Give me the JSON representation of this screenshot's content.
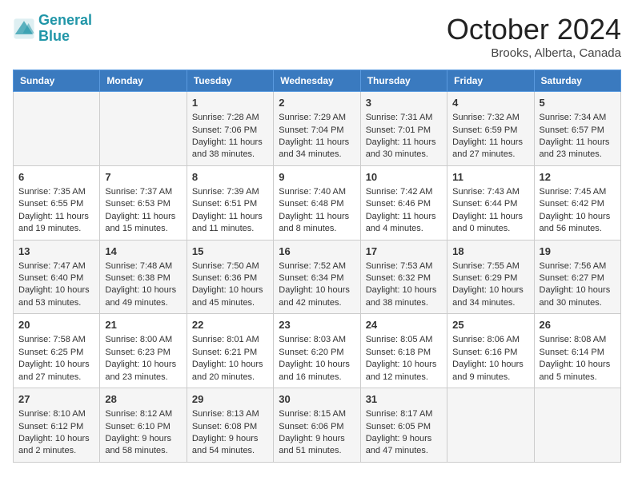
{
  "header": {
    "logo_line1": "General",
    "logo_line2": "Blue",
    "month": "October 2024",
    "location": "Brooks, Alberta, Canada"
  },
  "days_of_week": [
    "Sunday",
    "Monday",
    "Tuesday",
    "Wednesday",
    "Thursday",
    "Friday",
    "Saturday"
  ],
  "weeks": [
    [
      {
        "day": "",
        "content": ""
      },
      {
        "day": "",
        "content": ""
      },
      {
        "day": "1",
        "content": "Sunrise: 7:28 AM\nSunset: 7:06 PM\nDaylight: 11 hours and 38 minutes."
      },
      {
        "day": "2",
        "content": "Sunrise: 7:29 AM\nSunset: 7:04 PM\nDaylight: 11 hours and 34 minutes."
      },
      {
        "day": "3",
        "content": "Sunrise: 7:31 AM\nSunset: 7:01 PM\nDaylight: 11 hours and 30 minutes."
      },
      {
        "day": "4",
        "content": "Sunrise: 7:32 AM\nSunset: 6:59 PM\nDaylight: 11 hours and 27 minutes."
      },
      {
        "day": "5",
        "content": "Sunrise: 7:34 AM\nSunset: 6:57 PM\nDaylight: 11 hours and 23 minutes."
      }
    ],
    [
      {
        "day": "6",
        "content": "Sunrise: 7:35 AM\nSunset: 6:55 PM\nDaylight: 11 hours and 19 minutes."
      },
      {
        "day": "7",
        "content": "Sunrise: 7:37 AM\nSunset: 6:53 PM\nDaylight: 11 hours and 15 minutes."
      },
      {
        "day": "8",
        "content": "Sunrise: 7:39 AM\nSunset: 6:51 PM\nDaylight: 11 hours and 11 minutes."
      },
      {
        "day": "9",
        "content": "Sunrise: 7:40 AM\nSunset: 6:48 PM\nDaylight: 11 hours and 8 minutes."
      },
      {
        "day": "10",
        "content": "Sunrise: 7:42 AM\nSunset: 6:46 PM\nDaylight: 11 hours and 4 minutes."
      },
      {
        "day": "11",
        "content": "Sunrise: 7:43 AM\nSunset: 6:44 PM\nDaylight: 11 hours and 0 minutes."
      },
      {
        "day": "12",
        "content": "Sunrise: 7:45 AM\nSunset: 6:42 PM\nDaylight: 10 hours and 56 minutes."
      }
    ],
    [
      {
        "day": "13",
        "content": "Sunrise: 7:47 AM\nSunset: 6:40 PM\nDaylight: 10 hours and 53 minutes."
      },
      {
        "day": "14",
        "content": "Sunrise: 7:48 AM\nSunset: 6:38 PM\nDaylight: 10 hours and 49 minutes."
      },
      {
        "day": "15",
        "content": "Sunrise: 7:50 AM\nSunset: 6:36 PM\nDaylight: 10 hours and 45 minutes."
      },
      {
        "day": "16",
        "content": "Sunrise: 7:52 AM\nSunset: 6:34 PM\nDaylight: 10 hours and 42 minutes."
      },
      {
        "day": "17",
        "content": "Sunrise: 7:53 AM\nSunset: 6:32 PM\nDaylight: 10 hours and 38 minutes."
      },
      {
        "day": "18",
        "content": "Sunrise: 7:55 AM\nSunset: 6:29 PM\nDaylight: 10 hours and 34 minutes."
      },
      {
        "day": "19",
        "content": "Sunrise: 7:56 AM\nSunset: 6:27 PM\nDaylight: 10 hours and 30 minutes."
      }
    ],
    [
      {
        "day": "20",
        "content": "Sunrise: 7:58 AM\nSunset: 6:25 PM\nDaylight: 10 hours and 27 minutes."
      },
      {
        "day": "21",
        "content": "Sunrise: 8:00 AM\nSunset: 6:23 PM\nDaylight: 10 hours and 23 minutes."
      },
      {
        "day": "22",
        "content": "Sunrise: 8:01 AM\nSunset: 6:21 PM\nDaylight: 10 hours and 20 minutes."
      },
      {
        "day": "23",
        "content": "Sunrise: 8:03 AM\nSunset: 6:20 PM\nDaylight: 10 hours and 16 minutes."
      },
      {
        "day": "24",
        "content": "Sunrise: 8:05 AM\nSunset: 6:18 PM\nDaylight: 10 hours and 12 minutes."
      },
      {
        "day": "25",
        "content": "Sunrise: 8:06 AM\nSunset: 6:16 PM\nDaylight: 10 hours and 9 minutes."
      },
      {
        "day": "26",
        "content": "Sunrise: 8:08 AM\nSunset: 6:14 PM\nDaylight: 10 hours and 5 minutes."
      }
    ],
    [
      {
        "day": "27",
        "content": "Sunrise: 8:10 AM\nSunset: 6:12 PM\nDaylight: 10 hours and 2 minutes."
      },
      {
        "day": "28",
        "content": "Sunrise: 8:12 AM\nSunset: 6:10 PM\nDaylight: 9 hours and 58 minutes."
      },
      {
        "day": "29",
        "content": "Sunrise: 8:13 AM\nSunset: 6:08 PM\nDaylight: 9 hours and 54 minutes."
      },
      {
        "day": "30",
        "content": "Sunrise: 8:15 AM\nSunset: 6:06 PM\nDaylight: 9 hours and 51 minutes."
      },
      {
        "day": "31",
        "content": "Sunrise: 8:17 AM\nSunset: 6:05 PM\nDaylight: 9 hours and 47 minutes."
      },
      {
        "day": "",
        "content": ""
      },
      {
        "day": "",
        "content": ""
      }
    ]
  ]
}
